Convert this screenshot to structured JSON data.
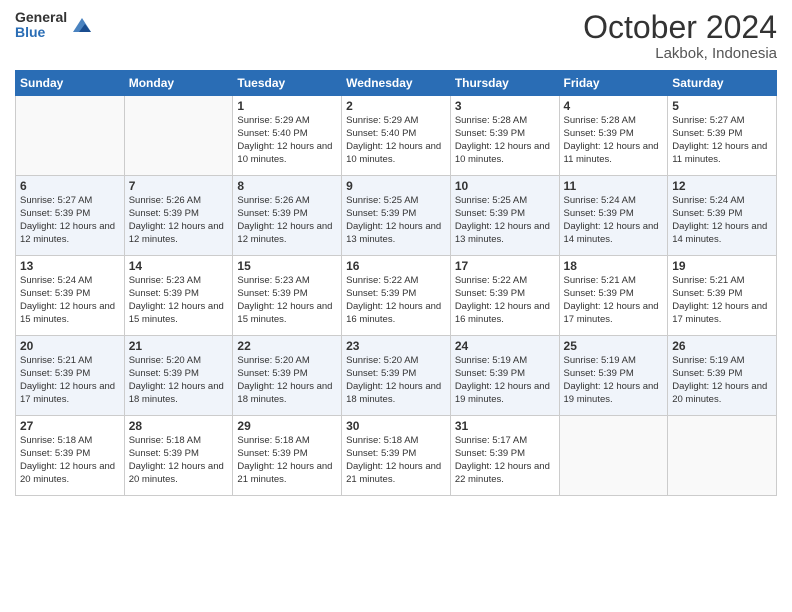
{
  "logo": {
    "general": "General",
    "blue": "Blue"
  },
  "title": "October 2024",
  "location": "Lakbok, Indonesia",
  "days_header": [
    "Sunday",
    "Monday",
    "Tuesday",
    "Wednesday",
    "Thursday",
    "Friday",
    "Saturday"
  ],
  "weeks": [
    [
      {
        "day": "",
        "sunrise": "",
        "sunset": "",
        "daylight": ""
      },
      {
        "day": "",
        "sunrise": "",
        "sunset": "",
        "daylight": ""
      },
      {
        "day": "1",
        "sunrise": "Sunrise: 5:29 AM",
        "sunset": "Sunset: 5:40 PM",
        "daylight": "Daylight: 12 hours and 10 minutes."
      },
      {
        "day": "2",
        "sunrise": "Sunrise: 5:29 AM",
        "sunset": "Sunset: 5:40 PM",
        "daylight": "Daylight: 12 hours and 10 minutes."
      },
      {
        "day": "3",
        "sunrise": "Sunrise: 5:28 AM",
        "sunset": "Sunset: 5:39 PM",
        "daylight": "Daylight: 12 hours and 10 minutes."
      },
      {
        "day": "4",
        "sunrise": "Sunrise: 5:28 AM",
        "sunset": "Sunset: 5:39 PM",
        "daylight": "Daylight: 12 hours and 11 minutes."
      },
      {
        "day": "5",
        "sunrise": "Sunrise: 5:27 AM",
        "sunset": "Sunset: 5:39 PM",
        "daylight": "Daylight: 12 hours and 11 minutes."
      }
    ],
    [
      {
        "day": "6",
        "sunrise": "Sunrise: 5:27 AM",
        "sunset": "Sunset: 5:39 PM",
        "daylight": "Daylight: 12 hours and 12 minutes."
      },
      {
        "day": "7",
        "sunrise": "Sunrise: 5:26 AM",
        "sunset": "Sunset: 5:39 PM",
        "daylight": "Daylight: 12 hours and 12 minutes."
      },
      {
        "day": "8",
        "sunrise": "Sunrise: 5:26 AM",
        "sunset": "Sunset: 5:39 PM",
        "daylight": "Daylight: 12 hours and 12 minutes."
      },
      {
        "day": "9",
        "sunrise": "Sunrise: 5:25 AM",
        "sunset": "Sunset: 5:39 PM",
        "daylight": "Daylight: 12 hours and 13 minutes."
      },
      {
        "day": "10",
        "sunrise": "Sunrise: 5:25 AM",
        "sunset": "Sunset: 5:39 PM",
        "daylight": "Daylight: 12 hours and 13 minutes."
      },
      {
        "day": "11",
        "sunrise": "Sunrise: 5:24 AM",
        "sunset": "Sunset: 5:39 PM",
        "daylight": "Daylight: 12 hours and 14 minutes."
      },
      {
        "day": "12",
        "sunrise": "Sunrise: 5:24 AM",
        "sunset": "Sunset: 5:39 PM",
        "daylight": "Daylight: 12 hours and 14 minutes."
      }
    ],
    [
      {
        "day": "13",
        "sunrise": "Sunrise: 5:24 AM",
        "sunset": "Sunset: 5:39 PM",
        "daylight": "Daylight: 12 hours and 15 minutes."
      },
      {
        "day": "14",
        "sunrise": "Sunrise: 5:23 AM",
        "sunset": "Sunset: 5:39 PM",
        "daylight": "Daylight: 12 hours and 15 minutes."
      },
      {
        "day": "15",
        "sunrise": "Sunrise: 5:23 AM",
        "sunset": "Sunset: 5:39 PM",
        "daylight": "Daylight: 12 hours and 15 minutes."
      },
      {
        "day": "16",
        "sunrise": "Sunrise: 5:22 AM",
        "sunset": "Sunset: 5:39 PM",
        "daylight": "Daylight: 12 hours and 16 minutes."
      },
      {
        "day": "17",
        "sunrise": "Sunrise: 5:22 AM",
        "sunset": "Sunset: 5:39 PM",
        "daylight": "Daylight: 12 hours and 16 minutes."
      },
      {
        "day": "18",
        "sunrise": "Sunrise: 5:21 AM",
        "sunset": "Sunset: 5:39 PM",
        "daylight": "Daylight: 12 hours and 17 minutes."
      },
      {
        "day": "19",
        "sunrise": "Sunrise: 5:21 AM",
        "sunset": "Sunset: 5:39 PM",
        "daylight": "Daylight: 12 hours and 17 minutes."
      }
    ],
    [
      {
        "day": "20",
        "sunrise": "Sunrise: 5:21 AM",
        "sunset": "Sunset: 5:39 PM",
        "daylight": "Daylight: 12 hours and 17 minutes."
      },
      {
        "day": "21",
        "sunrise": "Sunrise: 5:20 AM",
        "sunset": "Sunset: 5:39 PM",
        "daylight": "Daylight: 12 hours and 18 minutes."
      },
      {
        "day": "22",
        "sunrise": "Sunrise: 5:20 AM",
        "sunset": "Sunset: 5:39 PM",
        "daylight": "Daylight: 12 hours and 18 minutes."
      },
      {
        "day": "23",
        "sunrise": "Sunrise: 5:20 AM",
        "sunset": "Sunset: 5:39 PM",
        "daylight": "Daylight: 12 hours and 18 minutes."
      },
      {
        "day": "24",
        "sunrise": "Sunrise: 5:19 AM",
        "sunset": "Sunset: 5:39 PM",
        "daylight": "Daylight: 12 hours and 19 minutes."
      },
      {
        "day": "25",
        "sunrise": "Sunrise: 5:19 AM",
        "sunset": "Sunset: 5:39 PM",
        "daylight": "Daylight: 12 hours and 19 minutes."
      },
      {
        "day": "26",
        "sunrise": "Sunrise: 5:19 AM",
        "sunset": "Sunset: 5:39 PM",
        "daylight": "Daylight: 12 hours and 20 minutes."
      }
    ],
    [
      {
        "day": "27",
        "sunrise": "Sunrise: 5:18 AM",
        "sunset": "Sunset: 5:39 PM",
        "daylight": "Daylight: 12 hours and 20 minutes."
      },
      {
        "day": "28",
        "sunrise": "Sunrise: 5:18 AM",
        "sunset": "Sunset: 5:39 PM",
        "daylight": "Daylight: 12 hours and 20 minutes."
      },
      {
        "day": "29",
        "sunrise": "Sunrise: 5:18 AM",
        "sunset": "Sunset: 5:39 PM",
        "daylight": "Daylight: 12 hours and 21 minutes."
      },
      {
        "day": "30",
        "sunrise": "Sunrise: 5:18 AM",
        "sunset": "Sunset: 5:39 PM",
        "daylight": "Daylight: 12 hours and 21 minutes."
      },
      {
        "day": "31",
        "sunrise": "Sunrise: 5:17 AM",
        "sunset": "Sunset: 5:39 PM",
        "daylight": "Daylight: 12 hours and 22 minutes."
      },
      {
        "day": "",
        "sunrise": "",
        "sunset": "",
        "daylight": ""
      },
      {
        "day": "",
        "sunrise": "",
        "sunset": "",
        "daylight": ""
      }
    ]
  ]
}
